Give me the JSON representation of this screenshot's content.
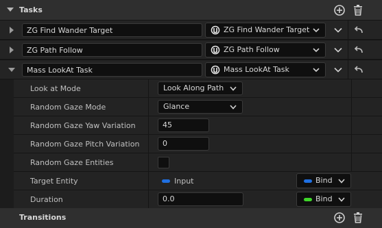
{
  "tasks_section": {
    "title": "Tasks"
  },
  "tasks": [
    {
      "name": "ZG Find Wander Target",
      "type": "ZG Find Wander Target",
      "expanded": false
    },
    {
      "name": "ZG Path Follow",
      "type": "ZG Path Follow",
      "expanded": false
    },
    {
      "name": "Mass LookAt Task",
      "type": "Mass LookAt Task",
      "expanded": true
    }
  ],
  "properties": {
    "look_at_mode": {
      "label": "Look at Mode",
      "value": "Look Along Path"
    },
    "random_gaze_mode": {
      "label": "Random Gaze Mode",
      "value": "Glance"
    },
    "yaw_variation": {
      "label": "Random Gaze Yaw Variation",
      "value": "45"
    },
    "pitch_variation": {
      "label": "Random Gaze Pitch Variation",
      "value": "0"
    },
    "gaze_entities": {
      "label": "Random Gaze Entities",
      "checked": false
    },
    "target_entity": {
      "label": "Target Entity",
      "input_label": "Input",
      "bind_label": "Bind",
      "pin_color": "#1f6fe0"
    },
    "duration": {
      "label": "Duration",
      "value": "0.0",
      "bind_label": "Bind",
      "pin_color": "#3fd52a"
    }
  },
  "transitions_section": {
    "title": "Transitions"
  },
  "icons": {
    "add": "plus-circle-icon",
    "delete": "trash-icon",
    "reset": "reset-arrow-icon",
    "task_type": "unreal-logo-icon"
  }
}
